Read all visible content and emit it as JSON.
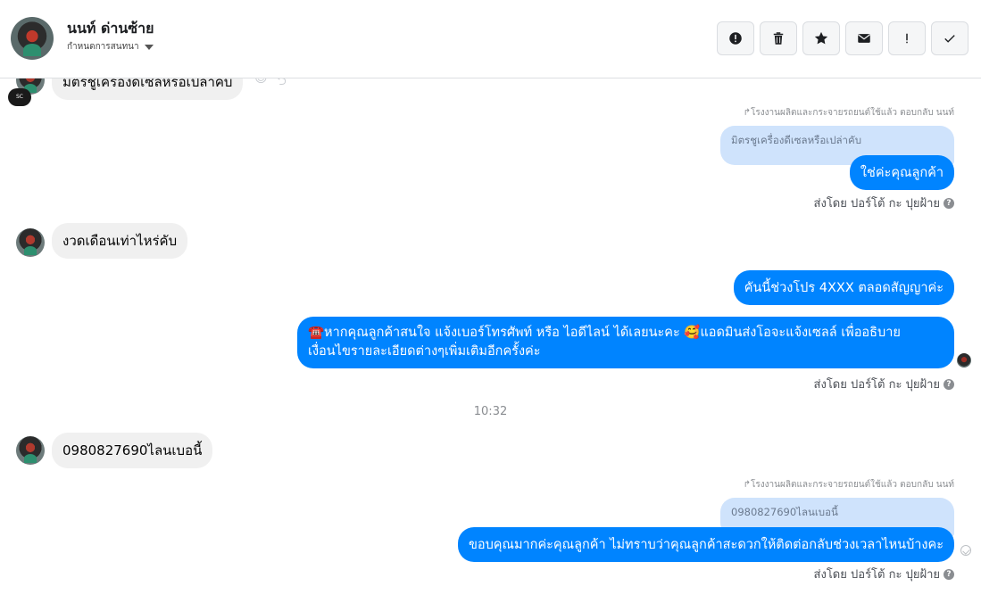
{
  "header": {
    "name": "นนท์ ด่านซ้าย",
    "subtitle": "กำหนดการสนทนา",
    "actions": [
      {
        "name": "spam-icon",
        "label": "!"
      },
      {
        "name": "trash-icon",
        "label": ""
      },
      {
        "name": "star-icon",
        "label": ""
      },
      {
        "name": "mail-icon",
        "label": ""
      },
      {
        "name": "important-icon",
        "label": "!"
      },
      {
        "name": "done-icon",
        "label": ""
      }
    ]
  },
  "messages": {
    "top_partial": "มิตรชูเครื่องดีเซลหรือเปล่าคับ",
    "reply1_note": "↱โรงงานผลิตและกระจายรถยนต์ใช้แล้ว ตอบกลับ นนท์",
    "reply1_quote": "มิตรชูเครื่องดีเซลหรือเปล่าคับ",
    "reply1_text": "ใช่ค่ะคุณลูกค้า",
    "sent_by": "ส่งโดย ปอร์โต้ กะ ปุยฝ้าย",
    "in2": "งวดเดือนเท่าไหร่คับ",
    "out2": "คันนี้ช่วงโปร 4XXX ตลอดสัญญาค่ะ",
    "out3_line1": "☎️หากคุณลูกค้าสนใจ แจ้งเบอร์โทรศัพท์ หรือ ไอดีไลน์  ได้เลยนะคะ 🥰แอดมินส่งโอจะแจ้งเซลล์   เพื่ออธิบาย",
    "out3_line2": "เงื่อนไขรายละเอียดต่างๆเพิ่มเติมอีกครั้งค่ะ",
    "time": "10:32",
    "in3": "0980827690ไลนเบอนี้",
    "reply2_note": "↱โรงงานผลิตและกระจายรถยนต์ใช้แล้ว ตอบกลับ นนท์",
    "reply2_quote": "0980827690ไลนเบอนี้",
    "reply2_text": "ขอบคุณมากค่ะคุณลูกค้า ไม่ทราบว่าคุณลูกค้าสะดวกให้ติดต่อกลับช่วงเวลาไหนบ้างคะ",
    "help_icon": "?"
  },
  "colors": {
    "accent": "#0084ff",
    "incoming_bubble": "#f0f0f0",
    "quote_bubble": "#cfe3fc"
  }
}
